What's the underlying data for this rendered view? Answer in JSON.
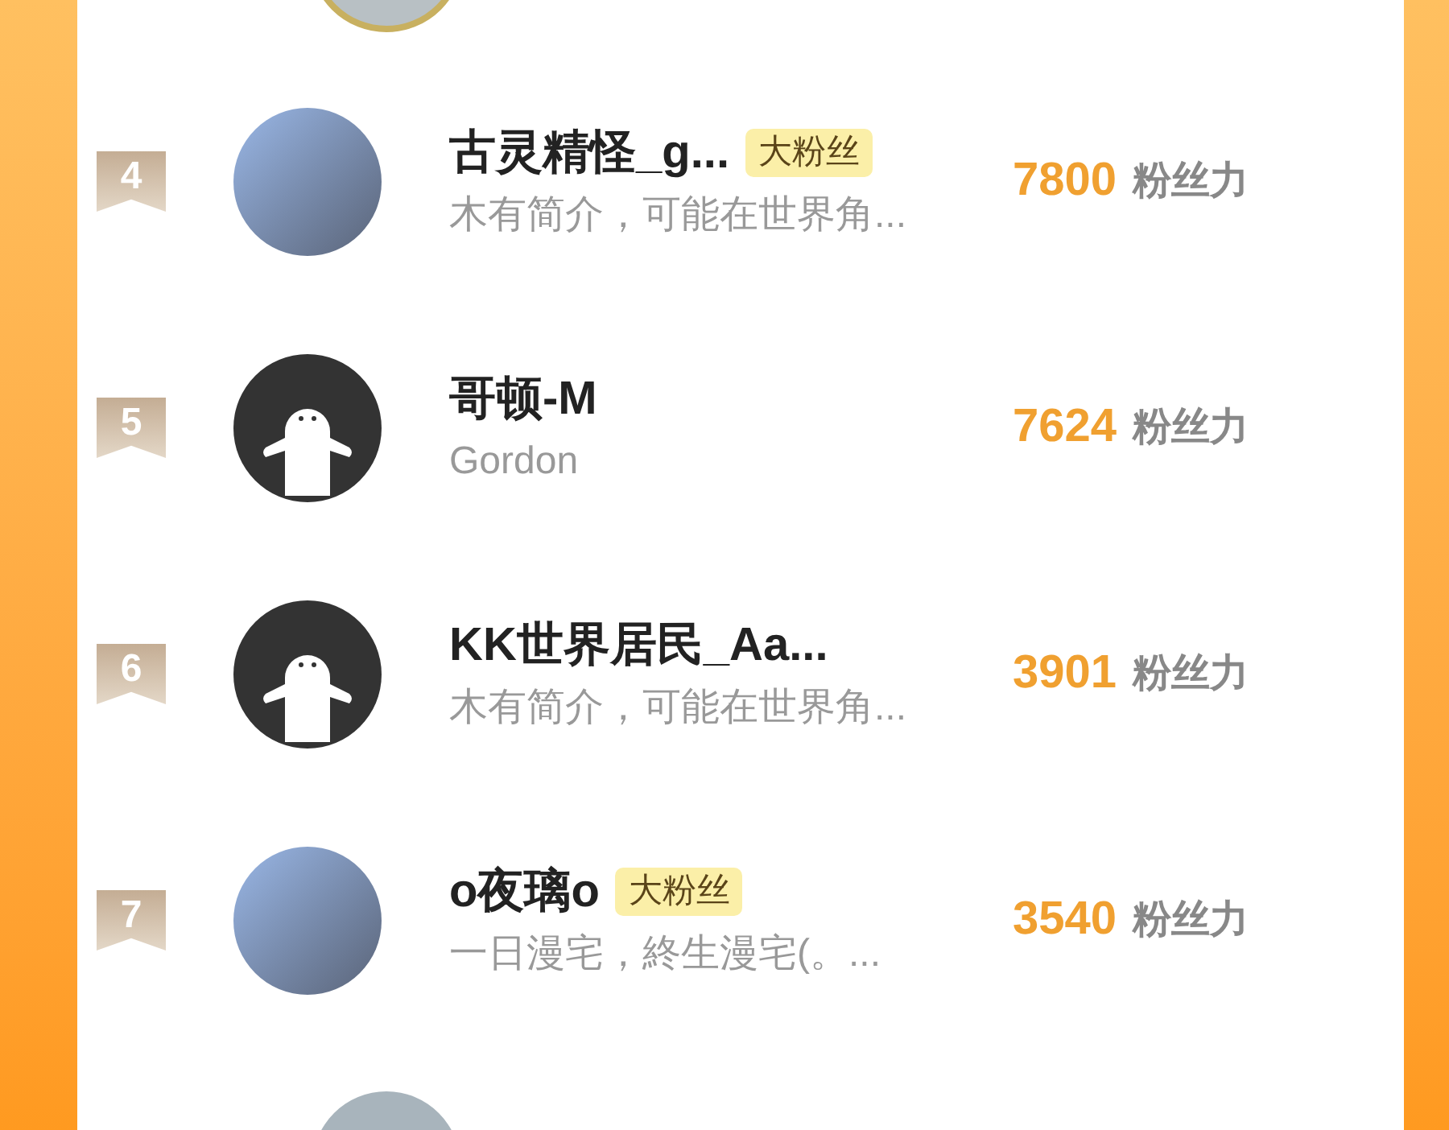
{
  "rows": [
    {
      "rank": "4",
      "kind": "photo",
      "name": "古灵精怪_g...",
      "badge": "大粉丝",
      "bio": "木有简介，可能在世界角...",
      "score": "7800",
      "score_unit": "粉丝力"
    },
    {
      "rank": "5",
      "kind": "default",
      "name": "哥顿-M",
      "bio": "Gordon",
      "score": "7624",
      "score_unit": "粉丝力"
    },
    {
      "rank": "6",
      "kind": "default",
      "name": "KK世界居民_Aa...",
      "bio": "木有简介，可能在世界角...",
      "score": "3901",
      "score_unit": "粉丝力"
    },
    {
      "rank": "7",
      "kind": "photo",
      "name": "o夜璃o",
      "badge": "大粉丝",
      "bio": "一日漫宅，終生漫宅(。...",
      "score": "3540",
      "score_unit": "粉丝力"
    }
  ]
}
